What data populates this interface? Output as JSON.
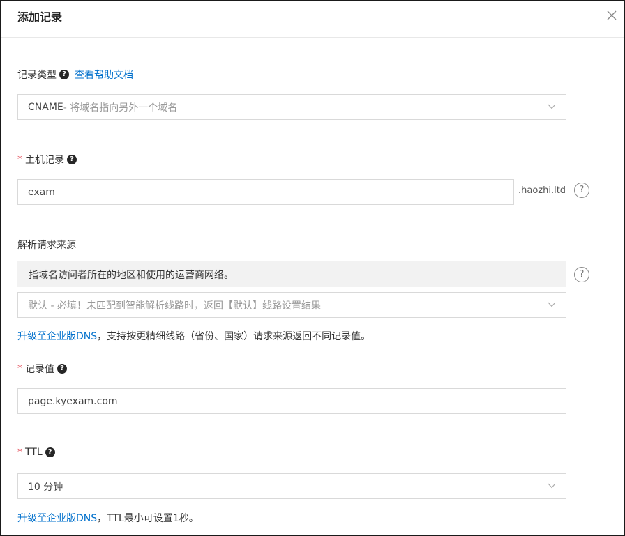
{
  "dialog": {
    "title": "添加记录"
  },
  "record_type": {
    "label": "记录类型",
    "help_icon": "question-icon",
    "help_link": "查看帮助文档",
    "value_prefix": "CNAME",
    "value_desc": "- 将域名指向另外一个域名"
  },
  "host_record": {
    "required_mark": "*",
    "label": "主机记录",
    "value": "exam",
    "domain_suffix": ".haozhi.ltd",
    "help_symbol": "?"
  },
  "resolve_source": {
    "label": "解析请求来源",
    "info_text": "指域名访问者所在的地区和使用的运营商网络。",
    "help_symbol": "?",
    "value": "默认 - 必填！未匹配到智能解析线路时，返回【默认】线路设置结果",
    "upgrade_link": "升级至企业版DNS",
    "upgrade_note": "，支持按更精细线路（省份、国家）请求来源返回不同记录值。"
  },
  "record_value": {
    "required_mark": "*",
    "label": "记录值",
    "value": "page.kyexam.com"
  },
  "ttl": {
    "required_mark": "*",
    "label": "TTL",
    "value": "10 分钟",
    "upgrade_link": "升级至企业版DNS",
    "upgrade_note": "，TTL最小可设置1秒。"
  },
  "icons": {
    "close": "close-icon",
    "chevron": "chevron-down-icon",
    "question": "question-icon"
  },
  "colors": {
    "link": "#0070cc",
    "required": "#e34d59",
    "border": "#d9d9d9",
    "info_bg": "#f2f2f2"
  }
}
